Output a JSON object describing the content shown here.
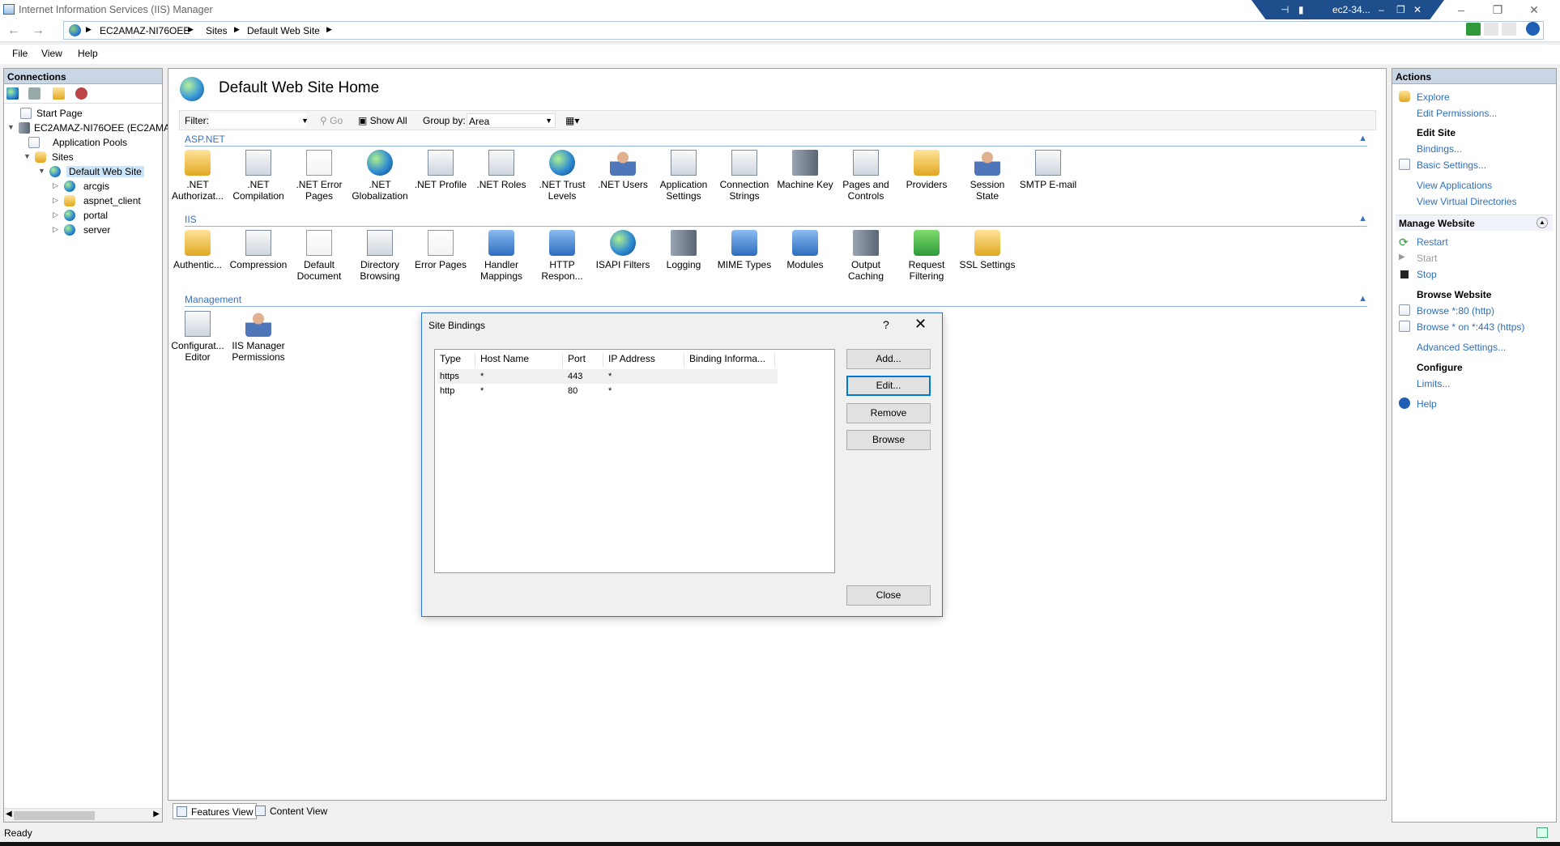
{
  "window": {
    "title": "Internet Information Services (IIS) Manager",
    "rdp_host": "ec2-34..."
  },
  "address": {
    "crumbs": [
      "EC2AMAZ-NI76OEE",
      "Sites",
      "Default Web Site"
    ]
  },
  "menu": [
    "File",
    "View",
    "Help"
  ],
  "connections": {
    "header": "Connections",
    "tree": [
      {
        "label": "Start Page"
      },
      {
        "label": "EC2AMAZ-NI76OEE (EC2AMA"
      },
      {
        "label": "Application Pools"
      },
      {
        "label": "Sites"
      },
      {
        "label": "Default Web Site"
      },
      {
        "label": "arcgis"
      },
      {
        "label": "aspnet_client"
      },
      {
        "label": "portal"
      },
      {
        "label": "server"
      }
    ]
  },
  "home": {
    "title": "Default Web Site Home",
    "filter_label": "Filter:",
    "go_label": "Go",
    "show_all_label": "Show All",
    "group_by_label": "Group by:",
    "group_by_value": "Area"
  },
  "sections": {
    "aspnet": {
      "title": "ASP.NET",
      "features": [
        {
          "label": ".NET Authorizat...",
          "icon": "lock-user-icon"
        },
        {
          "label": ".NET Compilation",
          "icon": "download-doc-icon"
        },
        {
          "label": ".NET Error Pages",
          "icon": "error-404-icon"
        },
        {
          "label": ".NET Globalization",
          "icon": "globe-icon"
        },
        {
          "label": ".NET Profile",
          "icon": "profile-doc-icon"
        },
        {
          "label": ".NET Roles",
          "icon": "roles-doc-icon"
        },
        {
          "label": ".NET Trust Levels",
          "icon": "trust-globe-icon"
        },
        {
          "label": ".NET Users",
          "icon": "users-icon"
        },
        {
          "label": "Application Settings",
          "icon": "settings-doc-icon"
        },
        {
          "label": "Connection Strings",
          "icon": "db-ab-icon"
        },
        {
          "label": "Machine Key",
          "icon": "machine-key-icon"
        },
        {
          "label": "Pages and Controls",
          "icon": "pages-icon"
        },
        {
          "label": "Providers",
          "icon": "providers-icon"
        },
        {
          "label": "Session State",
          "icon": "session-icon"
        },
        {
          "label": "SMTP E-mail",
          "icon": "mail-icon"
        }
      ]
    },
    "iis": {
      "title": "IIS",
      "features": [
        {
          "label": "Authentic...",
          "icon": "auth-icon"
        },
        {
          "label": "Compression",
          "icon": "compression-icon"
        },
        {
          "label": "Default Document",
          "icon": "default-doc-icon"
        },
        {
          "label": "Directory Browsing",
          "icon": "dir-browse-icon"
        },
        {
          "label": "Error Pages",
          "icon": "error-404-icon"
        },
        {
          "label": "Handler Mappings",
          "icon": "handler-icon"
        },
        {
          "label": "HTTP Respon...",
          "icon": "http-response-icon"
        },
        {
          "label": "ISAPI Filters",
          "icon": "isapi-icon"
        },
        {
          "label": "Logging",
          "icon": "logging-icon"
        },
        {
          "label": "MIME Types",
          "icon": "mime-icon"
        },
        {
          "label": "Modules",
          "icon": "modules-icon"
        },
        {
          "label": "Output Caching",
          "icon": "output-cache-icon"
        },
        {
          "label": "Request Filtering",
          "icon": "request-filter-icon"
        },
        {
          "label": "SSL Settings",
          "icon": "ssl-lock-icon"
        }
      ]
    },
    "management": {
      "title": "Management",
      "features": [
        {
          "label": "Configurat... Editor",
          "icon": "config-editor-icon"
        },
        {
          "label": "IIS Manager Permissions",
          "icon": "permissions-icon"
        }
      ]
    }
  },
  "view_tabs": {
    "features": "Features View",
    "content": "Content View"
  },
  "actions": {
    "header": "Actions",
    "explore": "Explore",
    "edit_permissions": "Edit Permissions...",
    "edit_site": "Edit Site",
    "bindings": "Bindings...",
    "basic_settings": "Basic Settings...",
    "view_applications": "View Applications",
    "view_virtual_directories": "View Virtual Directories",
    "manage_website": "Manage Website",
    "restart": "Restart",
    "start": "Start",
    "stop": "Stop",
    "browse_website": "Browse Website",
    "browse_80": "Browse *:80 (http)",
    "browse_443": "Browse * on *:443 (https)",
    "advanced_settings": "Advanced Settings...",
    "configure": "Configure",
    "limits": "Limits...",
    "help": "Help"
  },
  "status": {
    "text": "Ready"
  },
  "dialog": {
    "title": "Site Bindings",
    "help": "?",
    "columns": [
      "Type",
      "Host Name",
      "Port",
      "IP Address",
      "Binding Informa..."
    ],
    "rows": [
      {
        "type": "https",
        "host": "*",
        "port": "443",
        "ip": "*",
        "info": ""
      },
      {
        "type": "http",
        "host": "*",
        "port": "80",
        "ip": "*",
        "info": ""
      }
    ],
    "buttons": {
      "add": "Add...",
      "edit": "Edit...",
      "remove": "Remove",
      "browse": "Browse",
      "close": "Close"
    }
  }
}
